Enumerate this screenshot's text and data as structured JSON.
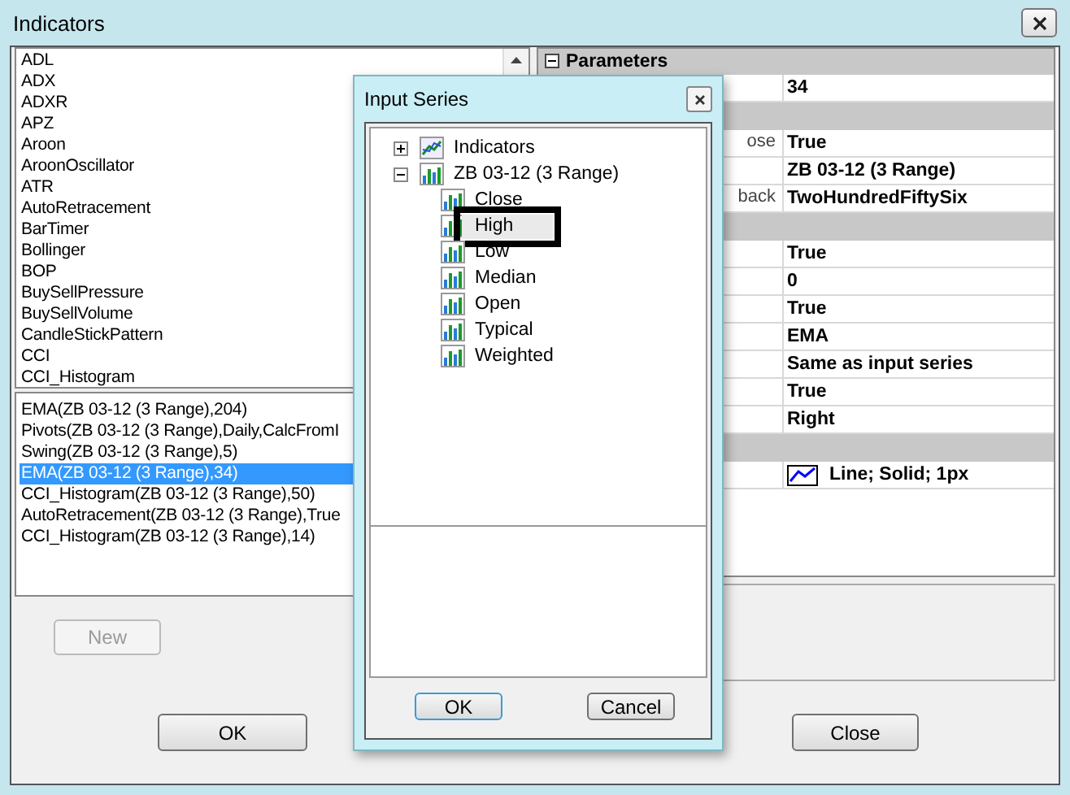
{
  "window": {
    "title": "Indicators"
  },
  "indicators": [
    "ADL",
    "ADX",
    "ADXR",
    "APZ",
    "Aroon",
    "AroonOscillator",
    "ATR",
    "AutoRetracement",
    "BarTimer",
    "Bollinger",
    "BOP",
    "BuySellPressure",
    "BuySellVolume",
    "CandleStickPattern",
    "CCI",
    "CCI_Histogram"
  ],
  "applied": [
    {
      "label": "EMA(ZB 03-12 (3 Range),204)",
      "selected": false
    },
    {
      "label": "Pivots(ZB 03-12 (3 Range),Daily,CalcFromI",
      "selected": false
    },
    {
      "label": "Swing(ZB 03-12 (3 Range),5)",
      "selected": false
    },
    {
      "label": "EMA(ZB 03-12 (3 Range),34)",
      "selected": true
    },
    {
      "label": "CCI_Histogram(ZB 03-12 (3 Range),50)",
      "selected": false
    },
    {
      "label": "AutoRetracement(ZB 03-12 (3 Range),True",
      "selected": false
    },
    {
      "label": "CCI_Histogram(ZB 03-12 (3 Range),14)",
      "selected": false
    }
  ],
  "new_button": {
    "label": "New",
    "disabled": true
  },
  "parameters": {
    "title": "Parameters",
    "expanded": true,
    "rows": [
      {
        "kind": "property",
        "value": "34"
      },
      {
        "kind": "category"
      },
      {
        "kind": "property",
        "label": "ose",
        "value": "True"
      },
      {
        "kind": "property",
        "value": "ZB 03-12 (3 Range)"
      },
      {
        "kind": "property",
        "label": "back",
        "value": "TwoHundredFiftySix"
      },
      {
        "kind": "category"
      },
      {
        "kind": "property",
        "value": "True"
      },
      {
        "kind": "property",
        "value": "0"
      },
      {
        "kind": "property",
        "value": "True"
      },
      {
        "kind": "property",
        "value": "EMA"
      },
      {
        "kind": "property",
        "value": "Same as input series"
      },
      {
        "kind": "property",
        "value": "True"
      },
      {
        "kind": "property",
        "value": "Right"
      },
      {
        "kind": "category"
      },
      {
        "kind": "plot",
        "value": "Line; Solid; 1px"
      }
    ]
  },
  "buttons": {
    "ok": "OK",
    "close": "Close"
  },
  "dialog": {
    "title": "Input Series",
    "tree": [
      {
        "label": "Indicators",
        "kind": "indicators",
        "expanded": false
      },
      {
        "label": "ZB 03-12 (3 Range)",
        "kind": "series",
        "expanded": true,
        "children": [
          {
            "label": "Close",
            "selected": false
          },
          {
            "label": "High",
            "selected": true
          },
          {
            "label": "Low",
            "selected": false
          },
          {
            "label": "Median",
            "selected": false
          },
          {
            "label": "Open",
            "selected": false
          },
          {
            "label": "Typical",
            "selected": false
          },
          {
            "label": "Weighted",
            "selected": false
          }
        ]
      }
    ],
    "buttons": [
      "OK",
      "Cancel"
    ]
  }
}
